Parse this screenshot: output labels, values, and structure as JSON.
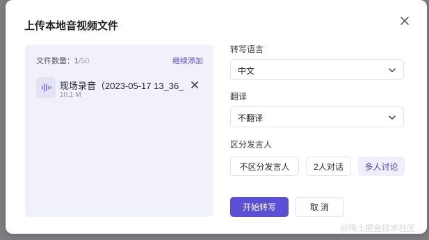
{
  "dialog": {
    "title": "上传本地音视频文件"
  },
  "files": {
    "count_label": "文件数量：",
    "count": "1",
    "max": "/50",
    "add_more": "继续添加",
    "items": [
      {
        "name": "现场录音（2023-05-17 13_36_1...",
        "size": "10.1 M"
      }
    ]
  },
  "form": {
    "language_label": "转写语言",
    "language_value": "中文",
    "translate_label": "翻译",
    "translate_value": "不翻译",
    "speaker_label": "区分发言人",
    "speaker_options": [
      "不区分发言人",
      "2人对话",
      "多人讨论"
    ],
    "speaker_selected": "多人讨论"
  },
  "actions": {
    "start": "开始转写",
    "cancel": "取 消"
  },
  "watermark": "@稀土掘金技术社区",
  "colors": {
    "accent": "#5b4fd6",
    "panel": "#f1f1fb"
  }
}
